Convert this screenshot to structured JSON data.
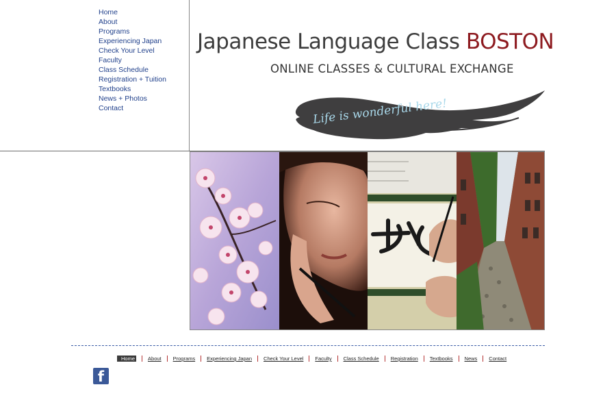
{
  "nav": {
    "items": [
      "Home",
      "About",
      "Programs",
      "Experiencing Japan",
      "Check Your Level",
      "Faculty",
      "Class Schedule",
      "Registration + Tuition",
      "Textbooks",
      "News + Photos",
      "Contact"
    ]
  },
  "header": {
    "title_main": "Japanese Language Class ",
    "title_accent": "BOSTON",
    "subtitle": "ONLINE CLASSES & CULTURAL EXCHANGE",
    "tagline": "Life is wonderful here!"
  },
  "colors": {
    "accent": "#8d1a1f",
    "nav_link": "#1f3f8a",
    "facebook": "#3b5998"
  },
  "footer": {
    "items": [
      "Home",
      "About",
      "Programs",
      "Experiencing Japan",
      "Check Your Level",
      "Faculty",
      "Class Schedule",
      "Registration",
      "Textbooks",
      "News",
      "Contact"
    ],
    "active_index": 0
  },
  "social": {
    "facebook_icon": "facebook-icon",
    "facebook_glyph": "f"
  }
}
